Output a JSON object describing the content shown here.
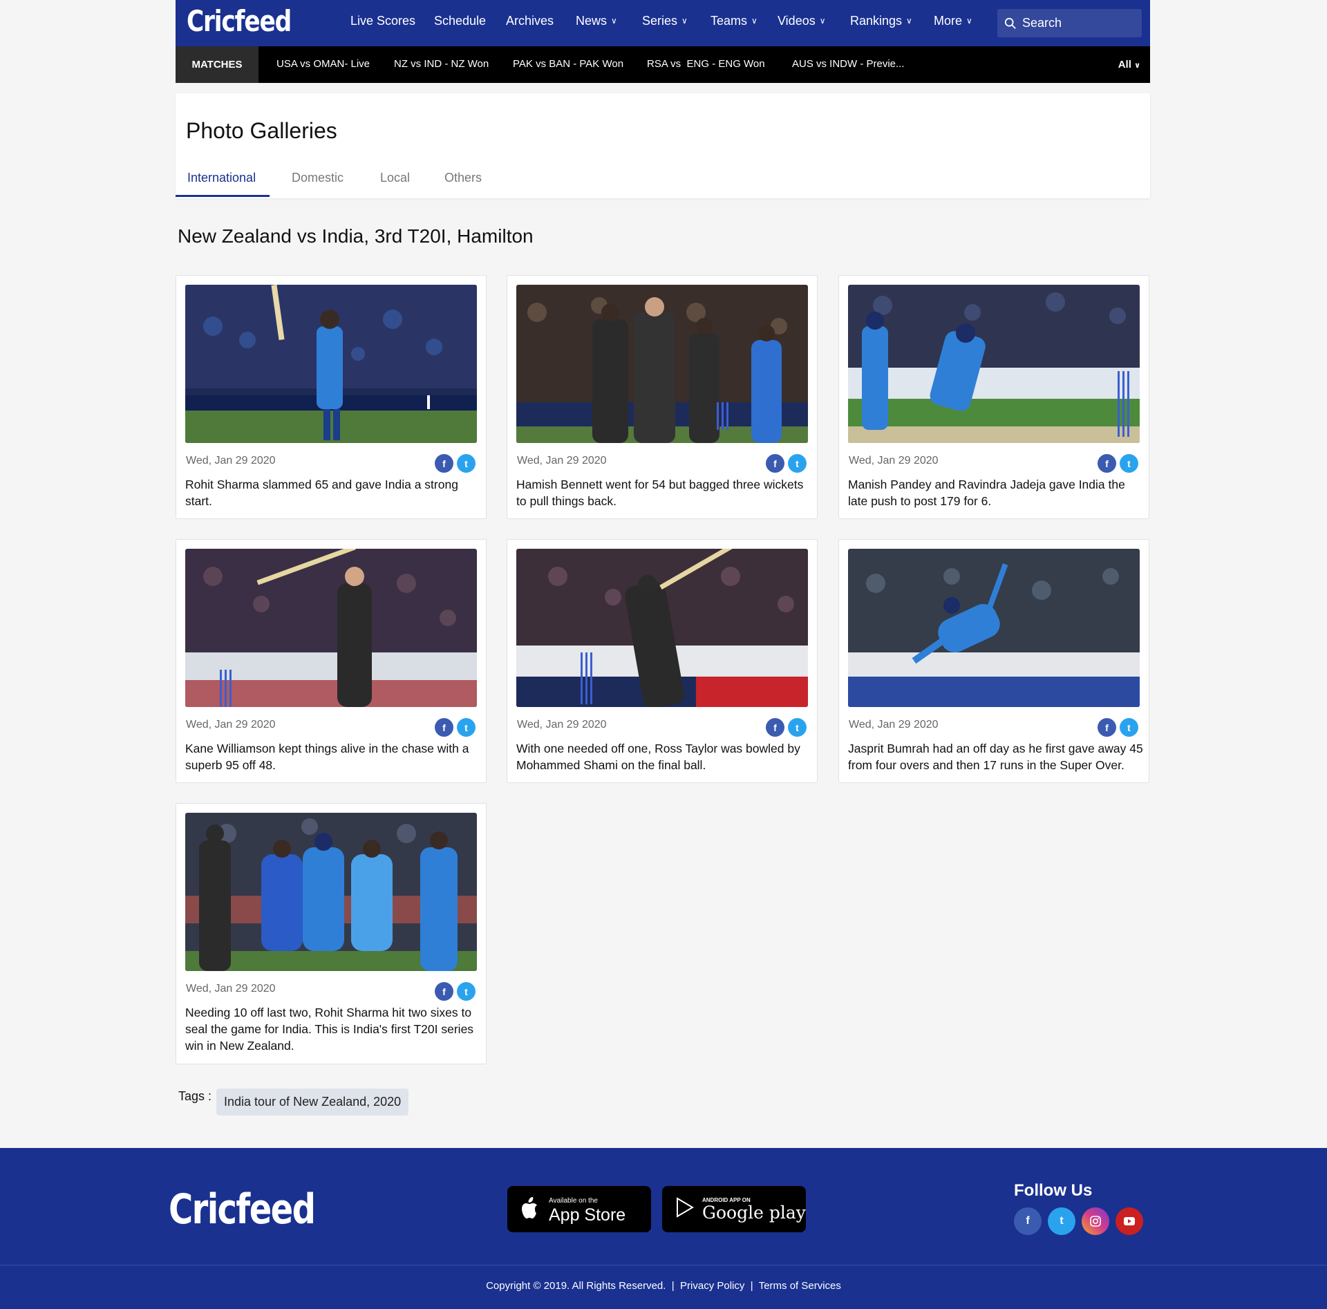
{
  "brand": "Cricfeed",
  "nav": {
    "items": [
      "Live Scores",
      "Schedule",
      "Archives",
      "News",
      "Series",
      "Teams",
      "Videos",
      "Rankings",
      "More"
    ],
    "search_placeholder": "Search"
  },
  "matches": {
    "label": "MATCHES",
    "items": [
      "USA vs OMAN- Live",
      "NZ vs IND - NZ Won",
      "PAK vs BAN - PAK Won",
      "RSA vs  ENG - ENG Won",
      "AUS vs INDW - Previe..."
    ],
    "filter": "All"
  },
  "gallery": {
    "title": "Photo Galleries",
    "tabs": [
      "International",
      "Domestic",
      "Local",
      "Others"
    ],
    "active_tab": "International"
  },
  "series_title": "New Zealand vs India, 3rd T20I, Hamilton",
  "photos": [
    {
      "date": "Wed, Jan 29 2020",
      "caption": "Rohit Sharma slammed 65 and gave India a strong start."
    },
    {
      "date": "Wed, Jan 29 2020",
      "caption": "Hamish Bennett went for 54 but bagged three wickets to pull things back."
    },
    {
      "date": "Wed, Jan 29 2020",
      "caption": "Manish Pandey and Ravindra Jadeja gave India the late push to post 179 for 6."
    },
    {
      "date": "Wed, Jan 29 2020",
      "caption": "Kane Williamson kept things alive in the chase with a superb 95 off 48."
    },
    {
      "date": "Wed, Jan 29 2020",
      "caption": "With one needed off one, Ross Taylor was bowled by  Mohammed Shami on the final ball."
    },
    {
      "date": "Wed, Jan 29 2020",
      "caption": "Jasprit Bumrah had an off day as he first gave away 45 from four overs and then 17 runs in the Super Over."
    },
    {
      "date": "Wed, Jan 29 2020",
      "caption": "Needing 10 off last two, Rohit Sharma hit two sixes to seal the game for India. This is India's first T20I series win in New Zealand."
    }
  ],
  "tags": {
    "label": "Tags :",
    "items": [
      "India tour of New Zealand, 2020"
    ]
  },
  "footer": {
    "app_store_small": "Available on the",
    "app_store_big": "App Store",
    "play_small": "ANDROID APP ON",
    "play_big": "Google play",
    "follow_title": "Follow Us",
    "copyright": "Copyright © 2019. All Rights Reserved.",
    "privacy": "Privacy Policy",
    "terms": "Terms of Services"
  },
  "colors": {
    "primary": "#1a3190",
    "facebook": "#3b5bb0",
    "twitter": "#2aa3ef",
    "instagram": "#d43d8a",
    "youtube": "#cc1f1f"
  }
}
